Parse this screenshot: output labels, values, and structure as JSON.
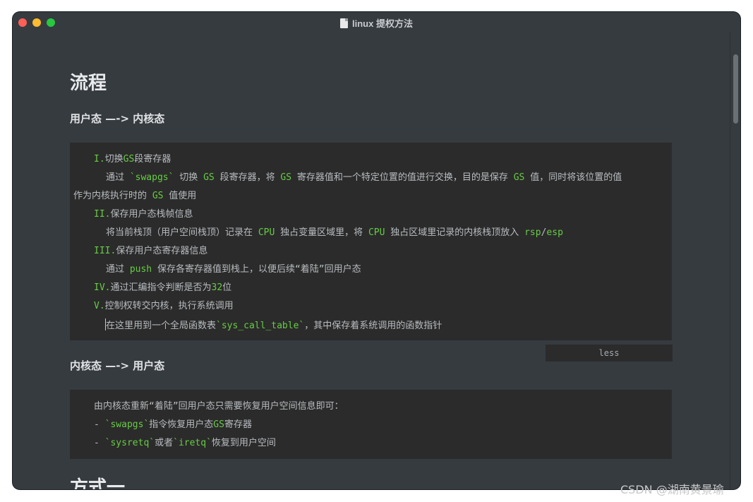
{
  "window": {
    "title": "linux 提权方法"
  },
  "content": {
    "heading1": "流程",
    "section1_title": "用户态 —-> 内核态",
    "block1": {
      "l1_num": "I.",
      "l1_pre": "切换",
      "l1_gs": "GS",
      "l1_post": "段寄存器",
      "l2_a": "通过 ",
      "l2_code": "`swapgs`",
      "l2_b": " 切换 ",
      "l2_gs1": "GS",
      "l2_c": " 段寄存器，将 ",
      "l2_gs2": "GS",
      "l2_d": " 寄存器值和一个特定位置的值进行交换，目的是保存 ",
      "l2_gs3": "GS",
      "l2_e": " 值，同时将该位置的值",
      "l3_a": "作为内核执行时的 ",
      "l3_gs": "GS",
      "l3_b": " 值使用",
      "l4_num": "II.",
      "l4_text": "保存用户态栈帧信息",
      "l5_a": "将当前栈顶（用户空间栈顶）记录在 ",
      "l5_cpu1": "CPU",
      "l5_b": " 独占变量区域里，将 ",
      "l5_cpu2": "CPU",
      "l5_c": " 独占区域里记录的内核栈顶放入 ",
      "l5_rsp": "rsp",
      "l5_slash": "/",
      "l5_esp": "esp",
      "l6_num": "III.",
      "l6_text": "保存用户态寄存器信息",
      "l7_a": "通过 ",
      "l7_push": "push",
      "l7_b": " 保存各寄存器值到栈上，以便后续“着陆”回用户态",
      "l8_num": "IV.",
      "l8_a": "通过汇编指令判断是否为",
      "l8_32": "32",
      "l8_b": "位",
      "l9_num": "V.",
      "l9_text": "控制权转交内核，执行系统调用",
      "l10_a": "在这里用到一个全局函数表",
      "l10_code": "`sys_call_table`",
      "l10_b": "，其中保存着系统调用的函数指针"
    },
    "lang_tag": "less",
    "section2_title": "内核态 —-> 用户态",
    "block2": {
      "l1": "由内核态重新“着陆”回用户态只需要恢复用户空间信息即可：",
      "l2_dash": "- ",
      "l2_code": "`swapgs`",
      "l2_a": "指令恢复用户态",
      "l2_gs": "GS",
      "l2_b": "寄存器",
      "l3_dash": "- ",
      "l3_code1": "`sysretq`",
      "l3_a": "或者",
      "l3_code2": "`iretq`",
      "l3_b": "恢复到用户空间"
    },
    "heading2": "方式一"
  },
  "watermark": "CSDN @湖南黄景瑜",
  "colors": {
    "background": "#363b40",
    "code_background": "#2b2b2b",
    "keyword_green": "#66cc44",
    "text": "#b8bcc0"
  }
}
